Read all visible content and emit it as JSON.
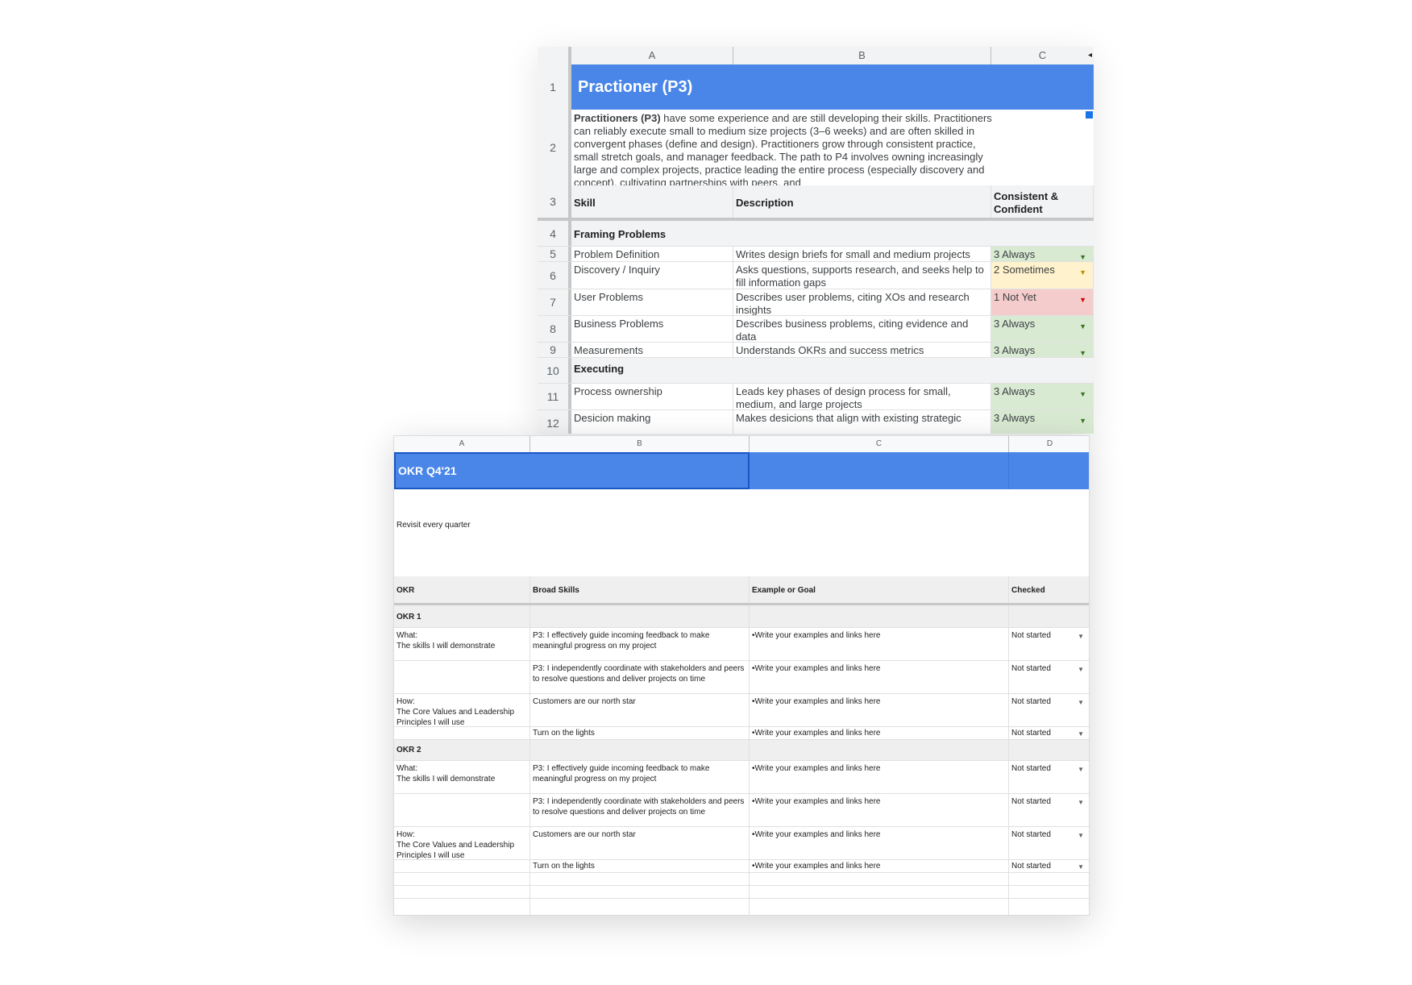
{
  "rubric_sheet": {
    "columns": [
      "A",
      "B",
      "C"
    ],
    "title": "Practioner (P3)",
    "intro_bold": "Practitioners (P3)",
    "intro_text": " have some experience and are still developing their skills. Practitioners can reliably execute small to medium size projects (3–6 weeks) and are often skilled in convergent phases (define and design). Practitioners grow through consistent practice, small stretch goals, and manager feedback. The path to P4 involves owning increasingly large and complex projects, practice leading the entire process (especially discovery and concept), cultivating partnerships with peers, and",
    "header": {
      "skill": "Skill",
      "description": "Description",
      "rating": "Consistent & Confident"
    },
    "rows": [
      {
        "num": "1"
      },
      {
        "num": "2"
      },
      {
        "num": "3"
      },
      {
        "num": "4",
        "section": "Framing Problems"
      },
      {
        "num": "5",
        "skill": "Problem Definition",
        "description": "Writes design briefs for small and medium projects",
        "rating": "3 Always",
        "status": "always"
      },
      {
        "num": "6",
        "skill": "Discovery / Inquiry",
        "description": "Asks questions, supports research, and seeks help to fill information gaps",
        "rating": "2 Sometimes",
        "status": "sometimes"
      },
      {
        "num": "7",
        "skill": "User Problems",
        "description": "Describes user problems, citing XOs and research insights",
        "rating": "1 Not Yet",
        "status": "notyet"
      },
      {
        "num": "8",
        "skill": "Business Problems",
        "description": "Describes business problems, citing evidence and data",
        "rating": "3 Always",
        "status": "always"
      },
      {
        "num": "9",
        "skill": "Measurements",
        "description": "Understands OKRs and success metrics",
        "rating": "3 Always",
        "status": "always"
      },
      {
        "num": "10",
        "section": "Executing"
      },
      {
        "num": "11",
        "skill": "Process ownership",
        "description": "Leads key phases of design process for small, medium, and large projects",
        "rating": "3 Always",
        "status": "always"
      },
      {
        "num": "12",
        "skill": "Desicion making",
        "description": "Makes desicions that align with existing strategic",
        "rating": "3 Always",
        "status": "always"
      }
    ],
    "dropdown_glyph": "▼",
    "collapse_glyph": "◂"
  },
  "okr_sheet": {
    "columns": [
      "A",
      "B",
      "C",
      "D"
    ],
    "title": "OKR Q4'21",
    "subtitle": "Revisit every quarter",
    "header": {
      "okr": "OKR",
      "skills": "Broad Skills",
      "example": "Example or Goal",
      "checked": "Checked"
    },
    "groups": [
      {
        "label": "OKR 1",
        "rows": [
          {
            "a": "What:\nThe skills I will demonstrate",
            "b": "P3: I effectively guide incoming feedback to make meaningful progress on my project",
            "c": "•Write your examples and links here",
            "d": "Not started"
          },
          {
            "a": "",
            "b": "P3: I independently coordinate with stakeholders and peers to resolve questions and deliver projects on time",
            "c": "•Write your examples and links here",
            "d": "Not started"
          },
          {
            "a": "How:\nThe Core Values and Leadership Principles I will use",
            "b": "Customers are our north star",
            "c": "•Write your examples and links here",
            "d": "Not started"
          },
          {
            "a": "",
            "b": "Turn on the lights",
            "c": "•Write your examples and links here",
            "d": "Not started"
          }
        ]
      },
      {
        "label": "OKR 2",
        "rows": [
          {
            "a": "What:\nThe skills I will demonstrate",
            "b": "P3: I effectively guide incoming feedback to make meaningful progress on my project",
            "c": "•Write your examples and links here",
            "d": "Not started"
          },
          {
            "a": "",
            "b": "P3: I independently coordinate with stakeholders and peers to resolve questions and deliver projects on time",
            "c": "•Write your examples and links here",
            "d": "Not started"
          },
          {
            "a": "How:\nThe Core Values and Leadership Principles I will use",
            "b": "Customers are our north star",
            "c": "•Write your examples and links here",
            "d": "Not started"
          },
          {
            "a": "",
            "b": "Turn on the lights",
            "c": "•Write your examples and links here",
            "d": "Not started"
          }
        ]
      }
    ],
    "dropdown_glyph": "▼"
  }
}
